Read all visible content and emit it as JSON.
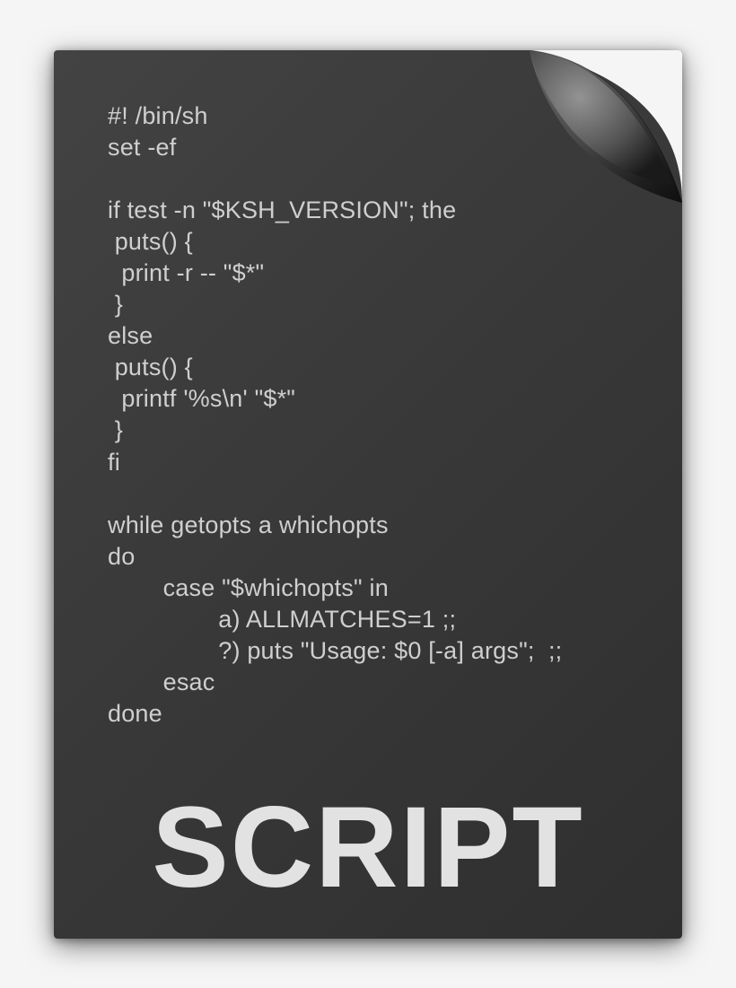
{
  "document": {
    "label": "SCRIPT",
    "code_lines": [
      "#! /bin/sh",
      "set -ef",
      "",
      "if test -n \"$KSH_VERSION\"; the",
      " puts() {",
      "  print -r -- \"$*\"",
      " }",
      "else",
      " puts() {",
      "  printf '%s\\n' \"$*\"",
      " }",
      "fi",
      "",
      "while getopts a whichopts",
      "do",
      "        case \"$whichopts\" in",
      "                a) ALLMATCHES=1 ;;",
      "                ?) puts \"Usage: $0 [-a] args\";  ;;",
      "        esac",
      "done"
    ]
  }
}
